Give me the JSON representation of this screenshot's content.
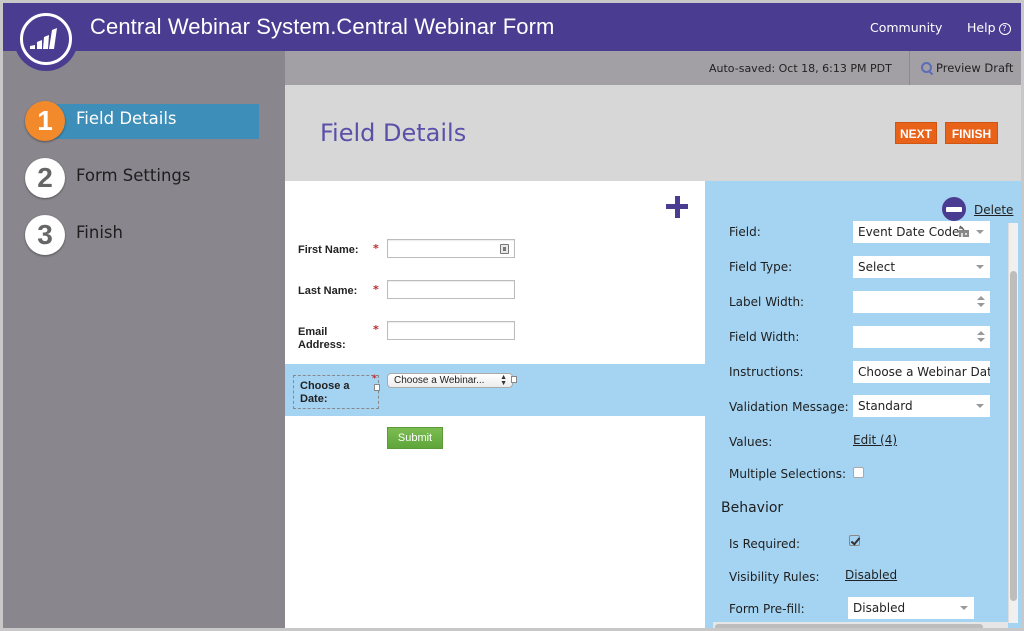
{
  "header": {
    "app_title": "Central Webinar System.Central Webinar Form",
    "links": {
      "community": "Community",
      "help": "Help"
    },
    "help_icon": "?",
    "brand_color": "#4a3d91"
  },
  "sidebar": {
    "steps": [
      {
        "number": "1",
        "label": "Field Details",
        "active": true
      },
      {
        "number": "2",
        "label": "Form Settings",
        "active": false
      },
      {
        "number": "3",
        "label": "Finish",
        "active": false
      }
    ]
  },
  "subbar": {
    "autosaved": "Auto-saved: Oct 18, 6:13 PM PDT",
    "preview_label": "Preview Draft"
  },
  "page": {
    "title": "Field Details",
    "next_label": "NEXT",
    "finish_label": "FINISH",
    "accent_color": "#e8621a"
  },
  "form_canvas": {
    "fields": [
      {
        "label": "First Name:",
        "required": "*",
        "value": ""
      },
      {
        "label": "Last Name:",
        "required": "*",
        "value": ""
      },
      {
        "label_line1": "Email",
        "label_line2": "Address:",
        "required": "*",
        "value": ""
      }
    ],
    "selected_field": {
      "label_line1": "Choose a",
      "label_line2": "Date:",
      "required": "*",
      "select_value": "Choose a Webinar...",
      "select_arrows": "▲▼"
    },
    "submit_label": "Submit"
  },
  "properties": {
    "delete_label": "Delete",
    "rows": {
      "field": {
        "label": "Field:",
        "value": "Event Date Code"
      },
      "field_type": {
        "label": "Field Type:",
        "value": "Select"
      },
      "label_width": {
        "label": "Label Width:",
        "value": ""
      },
      "field_width": {
        "label": "Field Width:",
        "value": ""
      },
      "instructions": {
        "label": "Instructions:",
        "value": "Choose a Webinar Date"
      },
      "validation_message": {
        "label": "Validation Message:",
        "value": "Standard"
      },
      "values": {
        "label": "Values:",
        "link": "Edit (4)"
      },
      "multiple_selections": {
        "label": "Multiple Selections:",
        "checked": false
      }
    },
    "behavior": {
      "title": "Behavior",
      "is_required": {
        "label": "Is Required:",
        "checked": true
      },
      "visibility_rules": {
        "label": "Visibility Rules:",
        "link": "Disabled"
      },
      "form_prefill": {
        "label": "Form Pre-fill:",
        "value": "Disabled"
      }
    },
    "panel_color": "#a5d4f3"
  }
}
